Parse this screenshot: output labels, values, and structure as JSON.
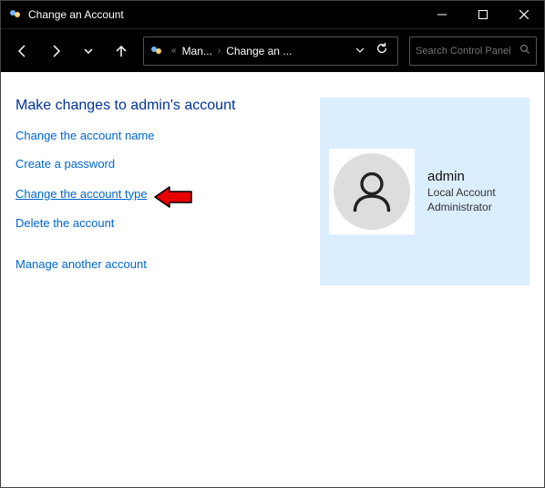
{
  "window": {
    "title": "Change an Account"
  },
  "breadcrumb": {
    "seg1": "Man...",
    "seg2": "Change an ..."
  },
  "search": {
    "placeholder": "Search Control Panel"
  },
  "heading": "Make changes to admin's account",
  "links": {
    "changeName": "Change the account name",
    "createPw": "Create a password",
    "changeType": "Change the account type",
    "delete": "Delete the account",
    "manage": "Manage another account"
  },
  "user": {
    "name": "admin",
    "type": "Local Account",
    "role": "Administrator"
  }
}
